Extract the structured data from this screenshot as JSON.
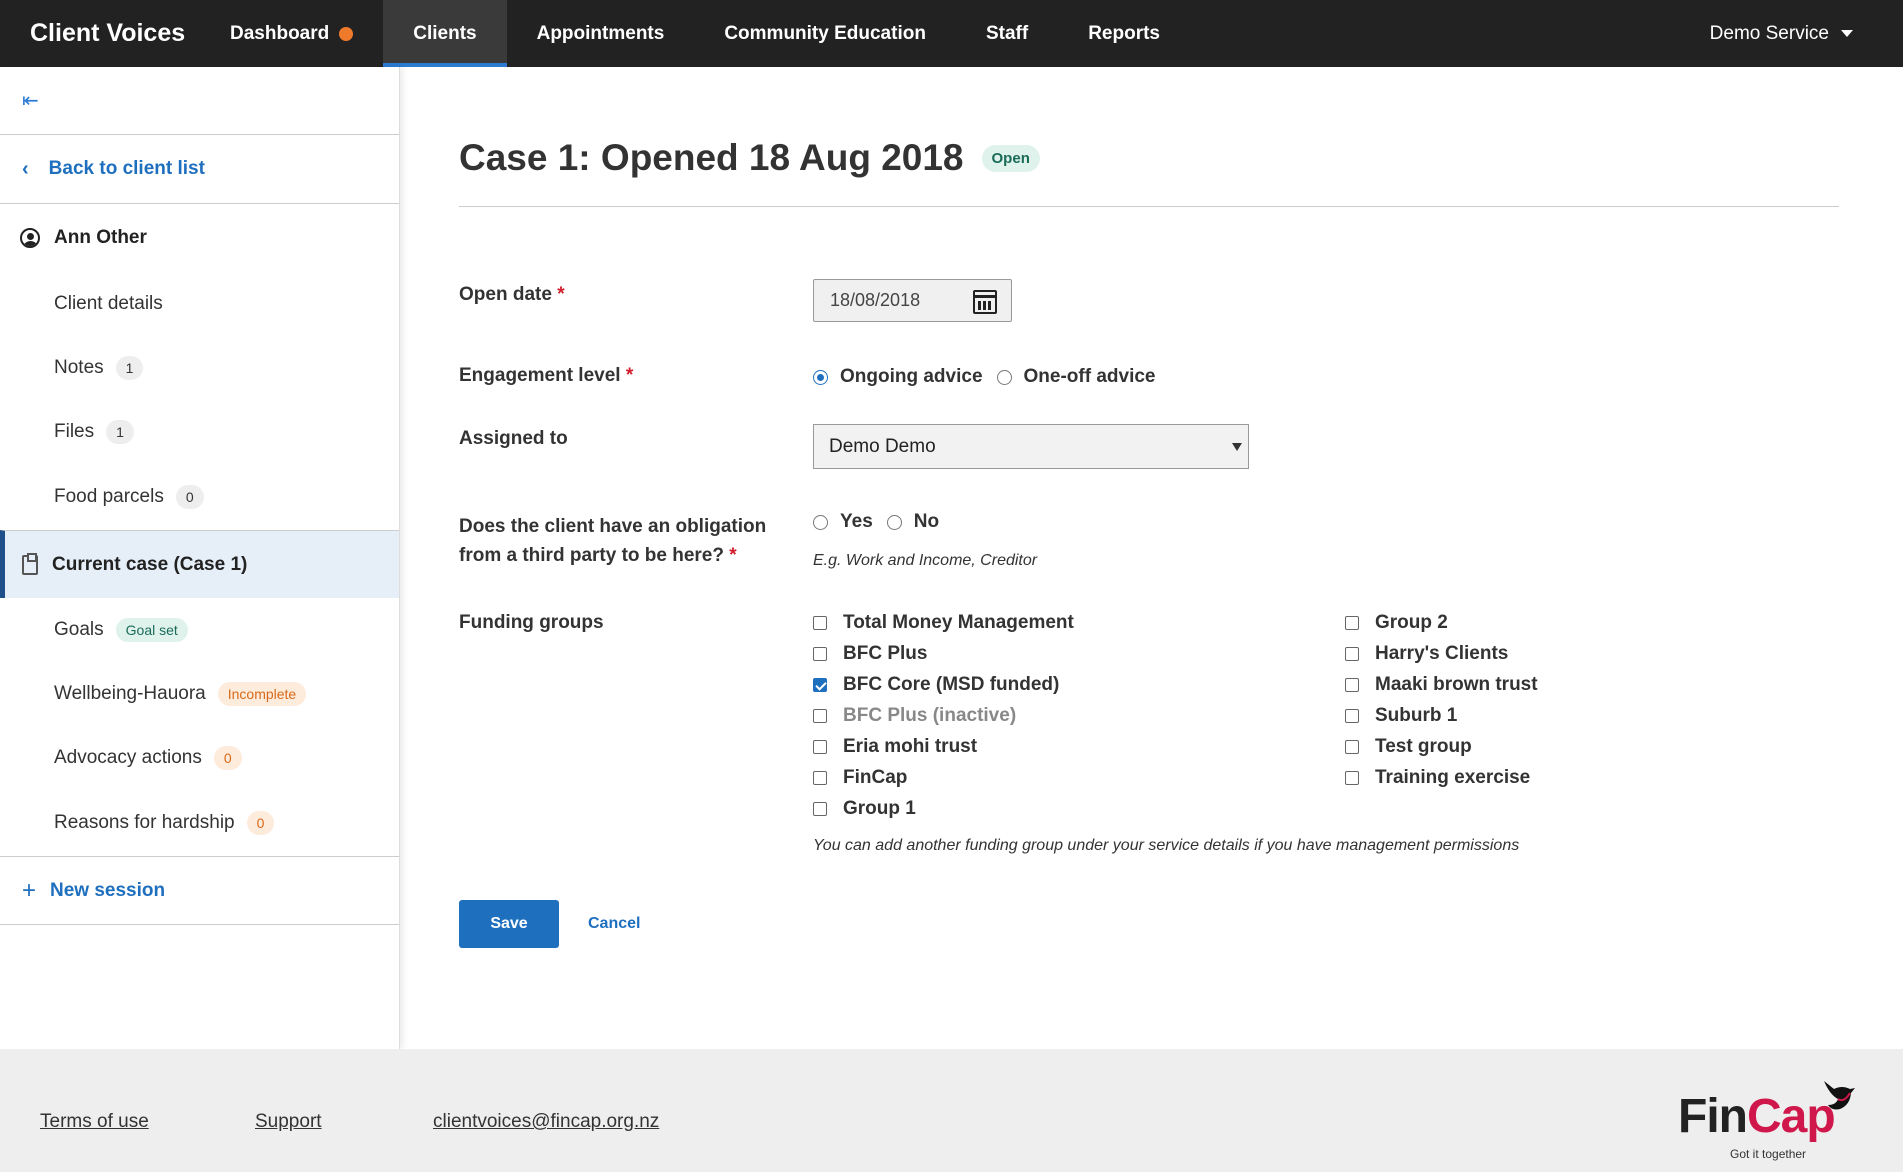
{
  "nav": {
    "brand": "Client Voices",
    "items": [
      "Dashboard",
      "Clients",
      "Appointments",
      "Community Education",
      "Staff",
      "Reports"
    ],
    "service": "Demo Service"
  },
  "sidebar": {
    "back": "Back to client list",
    "client_name": "Ann Other",
    "client_items": [
      {
        "label": "Client details",
        "badge": ""
      },
      {
        "label": "Notes",
        "badge": "1"
      },
      {
        "label": "Files",
        "badge": "1"
      },
      {
        "label": "Food parcels",
        "badge": "0"
      }
    ],
    "current_case": "Current case (Case 1)",
    "case_items": [
      {
        "label": "Goals",
        "badge": "Goal set"
      },
      {
        "label": "Wellbeing-Hauora",
        "badge": "Incomplete"
      },
      {
        "label": "Advocacy actions",
        "badge": "0"
      },
      {
        "label": "Reasons for hardship",
        "badge": "0"
      }
    ],
    "new_session": "New session"
  },
  "main": {
    "title": "Case 1: Opened 18 Aug 2018",
    "status": "Open",
    "open_date_label": "Open date",
    "open_date_value": "18/08/2018",
    "engagement_label": "Engagement level",
    "engagement_options": [
      "Ongoing advice",
      "One-off advice"
    ],
    "engagement_selected": "Ongoing advice",
    "assigned_label": "Assigned to",
    "assigned_value": "Demo Demo",
    "obligation_label_1": "Does the client have an obligation",
    "obligation_label_2": "from a third party to be here?",
    "obligation_options": [
      "Yes",
      "No"
    ],
    "obligation_hint": "E.g. Work and Income, Creditor",
    "funding_label": "Funding groups",
    "funding_col1": [
      "Total Money Management",
      "BFC Plus",
      "BFC Core (MSD funded)",
      "BFC Plus (inactive)",
      "Eria mohi trust",
      "FinCap",
      "Group 1"
    ],
    "funding_col2": [
      "Group 2",
      "Harry's Clients",
      "Maaki brown trust",
      "Suburb 1",
      "Test group",
      "Training exercise"
    ],
    "funding_checked": [
      "BFC Core (MSD funded)"
    ],
    "funding_hint": "You can add another funding group under your service details if you have management permissions",
    "save": "Save",
    "cancel": "Cancel"
  },
  "footer": {
    "terms": "Terms of use",
    "support": "Support",
    "email": "clientvoices@fincap.org.nz",
    "logo_fin": "Fin",
    "logo_cap": "Cap",
    "logo_tagline": "Got it together"
  },
  "colors": {
    "nav_bg": "#222222",
    "accent": "#1f6fbf",
    "brand_red": "#d0174b",
    "status_open": "#1a6b57"
  }
}
